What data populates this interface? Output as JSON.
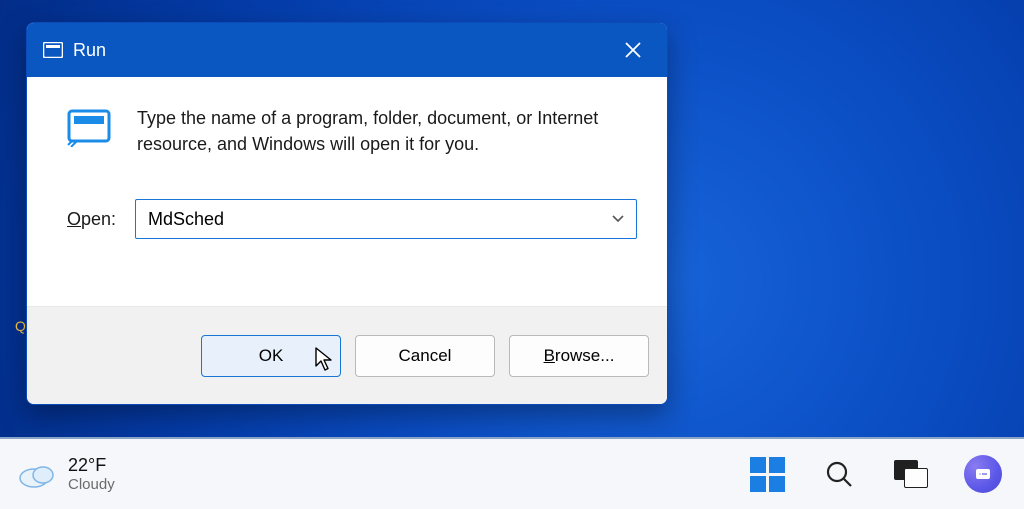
{
  "desktop_tag": "Q",
  "dialog": {
    "title": "Run",
    "intro": "Type the name of a program, folder, document, or Internet resource, and Windows will open it for you.",
    "open_label_underlined": "O",
    "open_label_rest": "pen:",
    "input_value": "MdSched",
    "ok_label": "OK",
    "cancel_label": "Cancel",
    "browse_underlined": "B",
    "browse_rest": "rowse..."
  },
  "taskbar": {
    "temp": "22°F",
    "condition": "Cloudy"
  }
}
